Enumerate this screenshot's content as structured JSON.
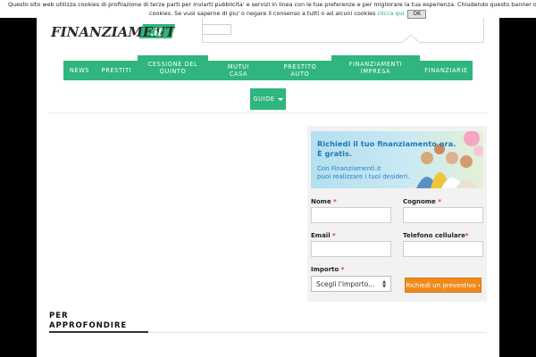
{
  "cookie_banner": {
    "text_line1": "Questo sito web utilizza cookies di profilazione di terze parti per inviarti pubblicita' e servizi in linea con le tue preferenze e per migliorare la tua esperienza. Chiudendo questo banner o cliccando qualunque elemento sottostante acconsenti all'uso dei",
    "text_line2": "cookies. Se vuoi saperne di piu' o negare il consenso a tutti o ad alcuni cookies",
    "link": "clicca qui",
    "ok_label": "OK"
  },
  "logo": {
    "text": "FINANZIAMENTI",
    "suffix": ".it"
  },
  "nav": {
    "news": "NEWS",
    "prestiti": "PRESTITI",
    "cessione": [
      "CESSIONE DEL",
      "QUINTO"
    ],
    "mutui": [
      "MUTUI",
      "CASA"
    ],
    "auto": [
      "PRESTITO",
      "AUTO"
    ],
    "impresa": [
      "FINANZIAMENTI",
      "IMPRESA"
    ],
    "finanziarie": "FINANZIARIE",
    "guide": "GUIDE"
  },
  "banner": {
    "title_line1": "Richiedi il tuo finanziamento ora.",
    "title_line2": "È gratis",
    "sub_line1": "Con Finanziamenti.it",
    "sub_line2": "puoi realizzare i tuoi desideri."
  },
  "form": {
    "nome_label": "Nome",
    "cognome_label": "Cognome",
    "email_label": "Email",
    "telefono_label": "Telefono cellulare",
    "importo_label": "Importo",
    "required_mark": "*",
    "importo_select": "Scegli l'importo...",
    "submit_label": "Richiedi un preventivo ›"
  },
  "section": {
    "title_line1": "PER",
    "title_line2": "APPROFONDIRE"
  },
  "colors": {
    "nav_green": "#2fb57d",
    "cta_orange": "#f08a1c",
    "banner_blue": "#1f79b5",
    "required_red": "#d23333"
  }
}
